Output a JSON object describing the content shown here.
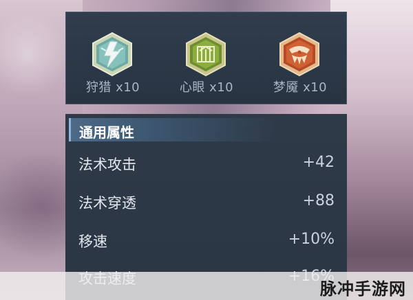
{
  "runes": [
    {
      "name": "狩猎",
      "count": "x10",
      "icon": "lightning-rune-icon",
      "color": "#7fb7b0"
    },
    {
      "name": "心眼",
      "count": "x10",
      "icon": "leaf-rune-icon",
      "color": "#8fa64c"
    },
    {
      "name": "梦魇",
      "count": "x10",
      "icon": "nightmare-rune-icon",
      "color": "#c4582c"
    }
  ],
  "attributes": {
    "title": "通用属性",
    "rows": [
      {
        "name": "法术攻击",
        "value": "+42"
      },
      {
        "name": "法术穿透",
        "value": "+88"
      },
      {
        "name": "移速",
        "value": "+10%"
      },
      {
        "name": "攻击速度",
        "value": "+16%"
      }
    ]
  },
  "watermark": "脉冲手游网"
}
